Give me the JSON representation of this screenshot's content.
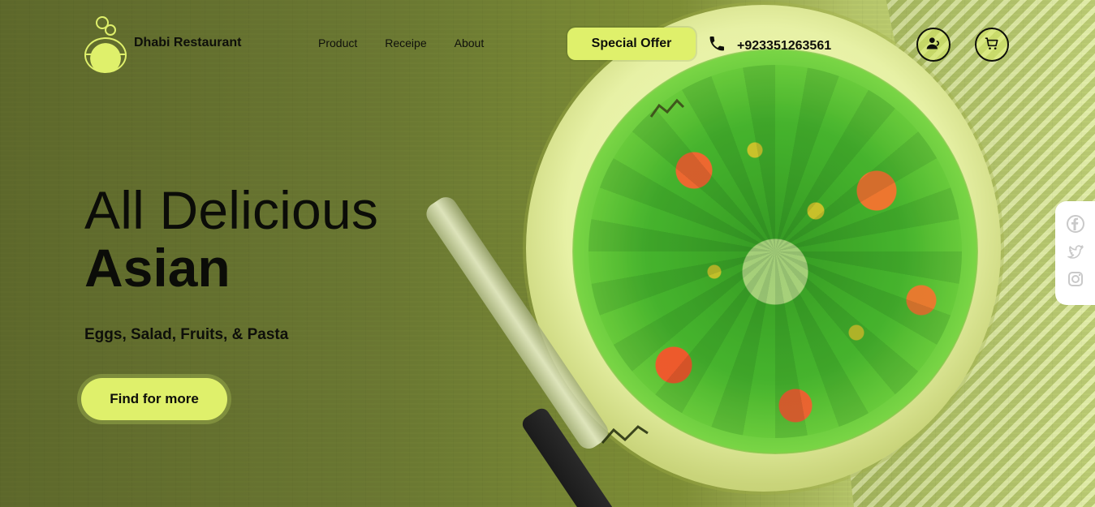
{
  "brand": {
    "name": "Dhabi Restaurant"
  },
  "nav": {
    "items": [
      "Product",
      "Receipe",
      "About"
    ]
  },
  "header": {
    "special_offer": "Special Offer",
    "phone": "+923351263561"
  },
  "hero": {
    "line1": "All Delicious",
    "line2": "Asian",
    "subtitle": "Eggs, Salad, Fruits, & Pasta",
    "cta": "Find for more"
  },
  "icons": {
    "logo": "bowl-logo-icon",
    "phone": "phone-icon",
    "user": "user-icon",
    "cart": "cart-icon",
    "facebook": "facebook-icon",
    "twitter": "twitter-icon",
    "instagram": "instagram-icon"
  },
  "colors": {
    "accent": "#dff06b",
    "text": "#0e0f0a"
  }
}
